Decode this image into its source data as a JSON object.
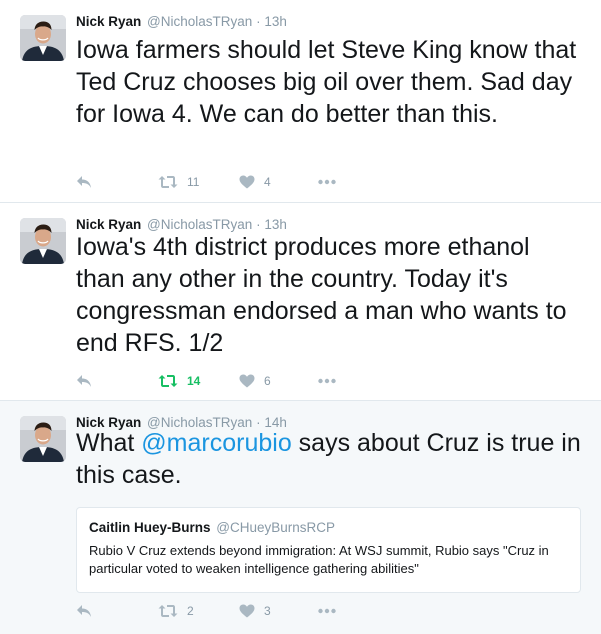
{
  "tweets": [
    {
      "author_name": "Nick Ryan",
      "author_handle": "@NicholasTRyan",
      "separator": "·",
      "time": "13h",
      "text": "Iowa farmers should let Steve King know that Ted Cruz chooses big oil over them. Sad day for Iowa 4. We can do better than this.",
      "retweet_count": "11",
      "like_count": "4",
      "retweeted": false
    },
    {
      "author_name": "Nick Ryan",
      "author_handle": "@NicholasTRyan",
      "separator": "·",
      "time": "13h",
      "text": "Iowa's 4th district produces more ethanol than any other in the country. Today it's congressman endorsed a man who wants to end RFS. 1/2",
      "retweet_count": "14",
      "like_count": "6",
      "retweeted": true
    },
    {
      "author_name": "Nick Ryan",
      "author_handle": "@NicholasTRyan",
      "separator": "·",
      "time": "14h",
      "text_before": "What ",
      "mention": "@marcorubio",
      "text_after": " says about Cruz is true in this case.",
      "retweet_count": "2",
      "like_count": "3",
      "retweeted": false,
      "quote": {
        "author_name": "Caitlin Huey-Burns",
        "author_handle": "@CHueyBurnsRCP",
        "text": "Rubio V Cruz extends beyond immigration:  At WSJ summit, Rubio says \"Cruz in particular voted to weaken intelligence gathering abilities\""
      }
    }
  ],
  "colors": {
    "text": "#14171a",
    "muted": "#8899a6",
    "link": "#1b95e0",
    "retweet_active": "#17bf63",
    "icon": "#aab8c2",
    "highlight_bg": "#f5f8fa",
    "border": "#e1e8ed"
  },
  "icons": {
    "reply": "reply-icon",
    "retweet": "retweet-icon",
    "like": "heart-icon",
    "more": "more-icon"
  }
}
